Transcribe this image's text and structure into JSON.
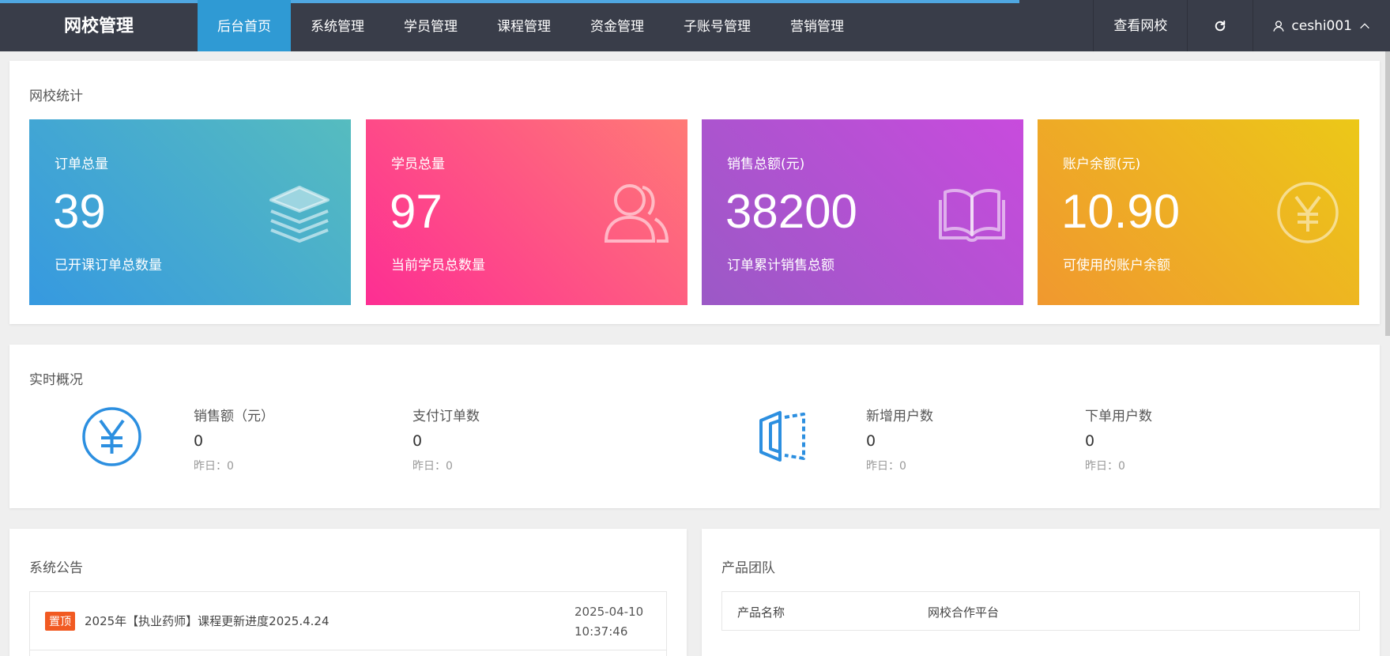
{
  "header": {
    "logo": "网校管理",
    "nav": [
      {
        "label": "后台首页",
        "active": true
      },
      {
        "label": "系统管理",
        "active": false
      },
      {
        "label": "学员管理",
        "active": false
      },
      {
        "label": "课程管理",
        "active": false
      },
      {
        "label": "资金管理",
        "active": false
      },
      {
        "label": "子账号管理",
        "active": false
      },
      {
        "label": "营销管理",
        "active": false
      }
    ],
    "view_school": "查看网校",
    "refresh_icon": "refresh-icon",
    "user_icon": "user-icon",
    "username": "ceshi001",
    "chevron_icon": "chevron-up-icon"
  },
  "stats": {
    "title": "网校统计",
    "cards": [
      {
        "label": "订单总量",
        "value": "39",
        "desc": "已开课订单总数量",
        "icon": "layers-icon",
        "colors": [
          "#3699e0",
          "#56bcbf"
        ]
      },
      {
        "label": "学员总量",
        "value": "97",
        "desc": "当前学员总数量",
        "icon": "users-icon",
        "colors": [
          "#fd2e93",
          "#ff7a76"
        ]
      },
      {
        "label": "销售总额(元)",
        "value": "38200",
        "desc": "订单累计销售总额",
        "icon": "book-icon",
        "colors": [
          "#9b59c6",
          "#c84bdd"
        ]
      },
      {
        "label": "账户余额(元)",
        "value": "10.90",
        "desc": "可使用的账户余额",
        "icon": "yen-icon",
        "colors": [
          "#f0982f",
          "#ecc818"
        ]
      }
    ]
  },
  "realtime": {
    "title": "实时概况",
    "items": [
      {
        "title": "销售额（元）",
        "value": "0",
        "yesterday": "昨日：0"
      },
      {
        "title": "支付订单数",
        "value": "0",
        "yesterday": "昨日：0"
      },
      {
        "title": "新增用户数",
        "value": "0",
        "yesterday": "昨日：0"
      },
      {
        "title": "下单用户数",
        "value": "0",
        "yesterday": "昨日：0"
      }
    ],
    "accent": "#2c8fe0"
  },
  "notice": {
    "title": "系统公告",
    "rows": [
      {
        "badge": "置顶",
        "text": "2025年【执业药师】课程更新进度2025.4.24",
        "date": "2025-04-10",
        "time": "10:37:46"
      }
    ]
  },
  "team": {
    "title": "产品团队",
    "rows": [
      {
        "key": "产品名称",
        "value": "网校合作平台"
      }
    ]
  }
}
